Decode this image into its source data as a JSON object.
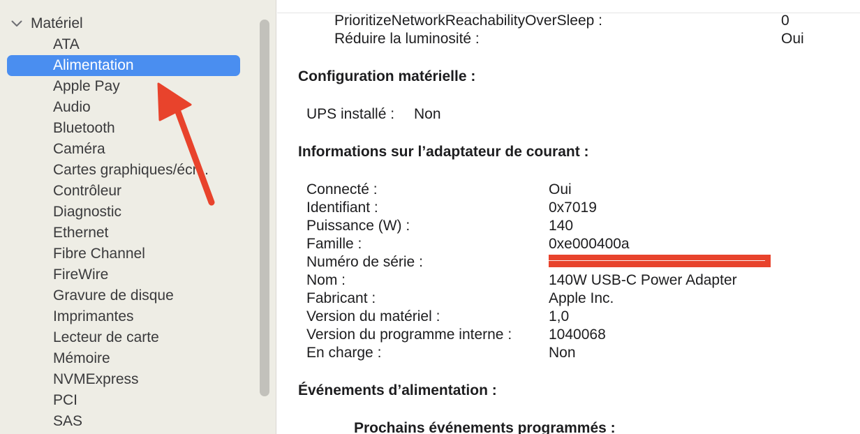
{
  "sidebar": {
    "group_label": "Matériel",
    "items": [
      {
        "label": "ATA"
      },
      {
        "label": "Alimentation",
        "selected": true
      },
      {
        "label": "Apple Pay"
      },
      {
        "label": "Audio"
      },
      {
        "label": "Bluetooth"
      },
      {
        "label": "Caméra"
      },
      {
        "label": "Cartes graphiques/écr..."
      },
      {
        "label": "Contrôleur"
      },
      {
        "label": "Diagnostic"
      },
      {
        "label": "Ethernet"
      },
      {
        "label": "Fibre Channel"
      },
      {
        "label": "FireWire"
      },
      {
        "label": "Gravure de disque"
      },
      {
        "label": "Imprimantes"
      },
      {
        "label": "Lecteur de carte"
      },
      {
        "label": "Mémoire"
      },
      {
        "label": "NVMExpress"
      },
      {
        "label": "PCI"
      },
      {
        "label": "SAS"
      }
    ],
    "selected_color": "#4a8ef0"
  },
  "annotation": {
    "arrow_color": "#e8432c"
  },
  "main": {
    "top_rows": [
      {
        "key": "PrioritizeNetworkReachabilityOverSleep :",
        "value": "0"
      },
      {
        "key": "Réduire la luminosité :",
        "value": "Oui"
      }
    ],
    "hardware_config": {
      "heading": "Configuration matérielle :",
      "ups_key": "UPS installé :",
      "ups_value": "Non"
    },
    "adapter": {
      "heading": "Informations sur l’adaptateur de courant :",
      "rows": [
        {
          "key": "Connecté :",
          "value": "Oui"
        },
        {
          "key": "Identifiant :",
          "value": "0x7019"
        },
        {
          "key": "Puissance (W) :",
          "value": "140"
        },
        {
          "key": "Famille :",
          "value": "0xe000400a"
        },
        {
          "key": "Numéro de série :",
          "value": ""
        },
        {
          "key": "Nom :",
          "value": "140W USB-C Power Adapter"
        },
        {
          "key": "Fabricant :",
          "value": "Apple Inc."
        },
        {
          "key": "Version du matériel :",
          "value": "1,0"
        },
        {
          "key": "Version du programme interne :",
          "value": "1040068"
        },
        {
          "key": "En charge :",
          "value": "Non"
        }
      ]
    },
    "power_events": {
      "heading": "Événements d’alimentation :",
      "subheading": "Prochains événements programmés :"
    },
    "redaction_color": "#e8432c"
  }
}
